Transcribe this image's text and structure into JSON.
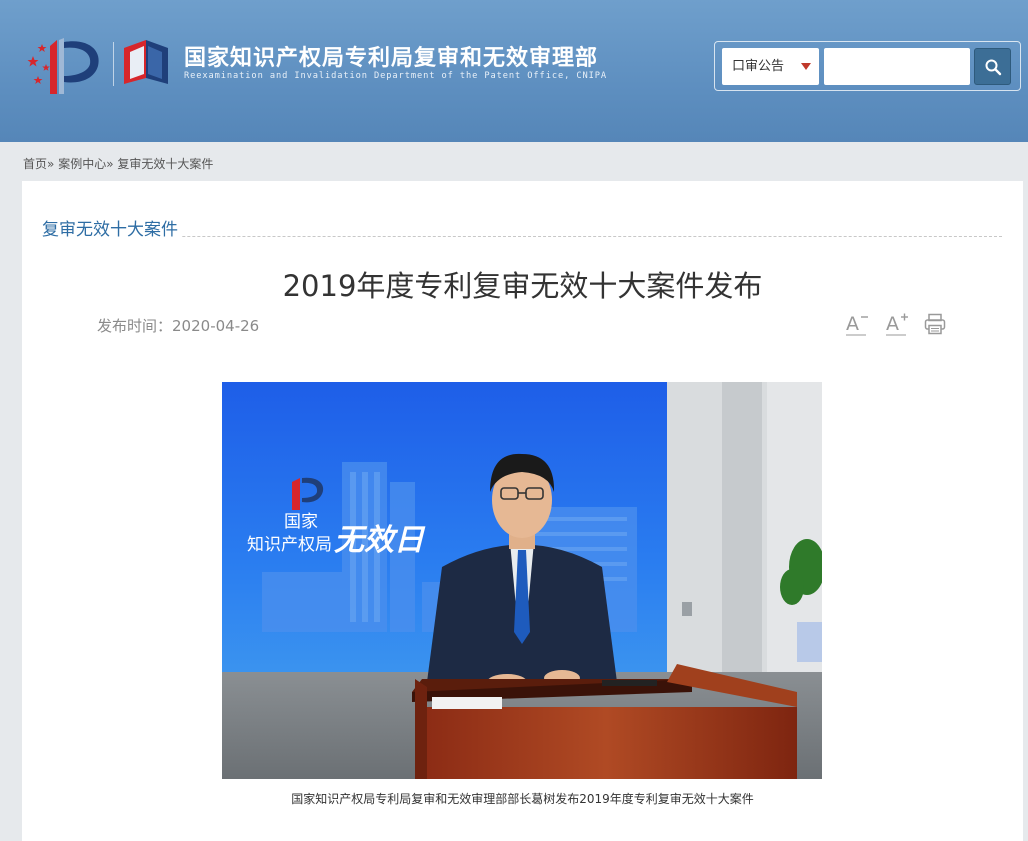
{
  "header": {
    "title": "国家知识产权局专利局复审和无效审理部",
    "subtitle": "Reexamination and Invalidation Department of the Patent Office, CNIPA",
    "colors": {
      "header_bg": "#6f9fcc",
      "search_button": "#3c6e96",
      "caret": "#c0392b"
    }
  },
  "search": {
    "category_selected": "口审公告",
    "input_value": "",
    "button_icon": "search-icon"
  },
  "breadcrumb": {
    "home": "首页",
    "sep1": "»",
    "cases": "案例中心",
    "sep2": "»",
    "current": "复审无效十大案件"
  },
  "section": {
    "title": "复审无效十大案件"
  },
  "article": {
    "title": "2019年度专利复审无效十大案件发布",
    "publish_label": "发布时间：",
    "publish_date": "2020-04-26",
    "tools": {
      "decrease_font_icon": "font-decrease-icon",
      "increase_font_icon": "font-increase-icon",
      "print_icon": "printer-icon"
    },
    "photo": {
      "logo_line1": "国家",
      "logo_line2": "知识产权局",
      "logo_script": "无效日",
      "caption": "国家知识产权局专利局复审和无效审理部部长葛树发布2019年度专利复审无效十大案件"
    }
  }
}
